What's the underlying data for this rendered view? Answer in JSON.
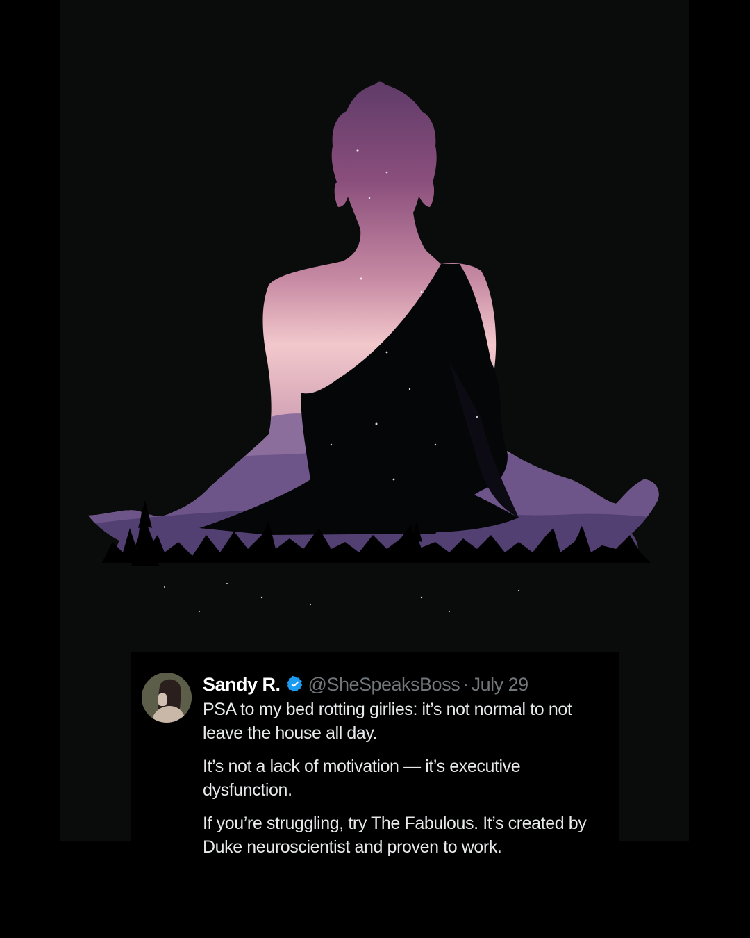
{
  "artwork": {
    "subject": "meditating-buddha-silhouette",
    "colors": {
      "sky_top": "#5e3a66",
      "sky_mid": "#9a5a82",
      "sky_glow": "#f2c8cc",
      "mountains": "#6f5a8c",
      "forest": "#000000",
      "background": "#0a0b0b"
    }
  },
  "tweet": {
    "author_name": "Sandy R.",
    "verified_icon": "verified-badge-icon",
    "handle": "@SheSpeaksBoss",
    "separator": "·",
    "date": "July 29",
    "paragraphs": [
      "PSA to my bed rotting girlies: it’s not normal to not leave the house all day.",
      "It’s not a lack of motivation — it’s executive dysfunction.",
      "If you’re struggling, try The Fabulous. It’s created by Duke neuroscientist and proven to work."
    ],
    "colors": {
      "name": "#ffffff",
      "meta": "#71767b",
      "text": "#e7e9ea",
      "badge": "#1d9bf0"
    }
  }
}
